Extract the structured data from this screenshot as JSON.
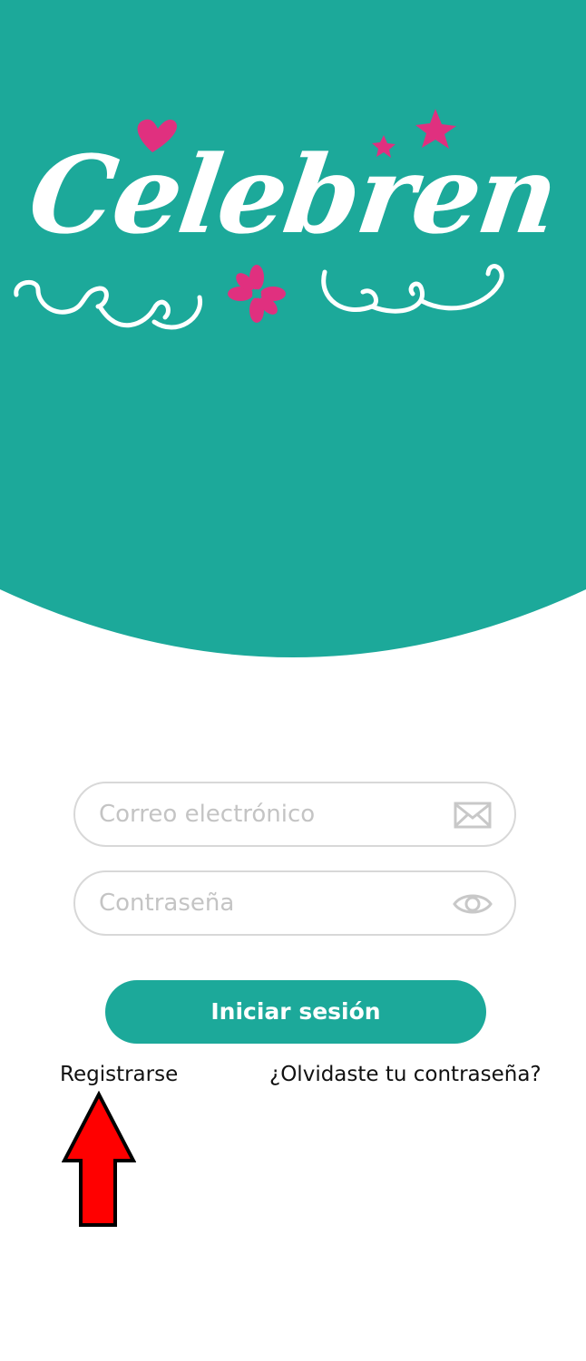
{
  "app": {
    "logo_text": "Celebren"
  },
  "colors": {
    "brand_teal": "#1ca99a",
    "accent_pink": "#e0307f",
    "annotation_red": "#ff0000"
  },
  "login_form": {
    "email_placeholder": "Correo electrónico",
    "email_icon": "envelope-icon",
    "password_placeholder": "Contraseña",
    "password_icon": "eye-icon",
    "submit_label": "Iniciar sesión"
  },
  "links": {
    "register_label": "Registrarse",
    "forgot_password_label": "¿Olvidaste tu contraseña?"
  },
  "annotation": {
    "type": "up-arrow",
    "target": "register-link"
  }
}
